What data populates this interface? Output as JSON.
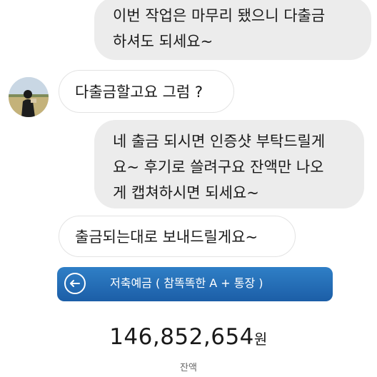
{
  "chat": {
    "messages": [
      {
        "sender": "me",
        "lines": [
          "이번 작업은 마무리 됐으니 다출금",
          "하셔도 되세요~"
        ]
      },
      {
        "sender": "other",
        "lines": [
          "다출금할고요 그럼 ?"
        ]
      },
      {
        "sender": "me",
        "lines": [
          "네 출금 되시면 인증샷 부탁드릴게",
          "요~ 후기로 쓸려구요  잔액만 나오",
          "게 캡쳐하시면 되세요~"
        ]
      },
      {
        "sender": "other",
        "lines": [
          "출금되는대로 보내드릴게요~"
        ]
      }
    ]
  },
  "bank": {
    "title": "저축예금 ( 참똑똑한 A + 통장 )",
    "back_icon": "back-arrow-icon",
    "balance": "146,852,654",
    "balance_unit": "원",
    "balance_label": "잔액",
    "header_color": "#1f64ad"
  }
}
